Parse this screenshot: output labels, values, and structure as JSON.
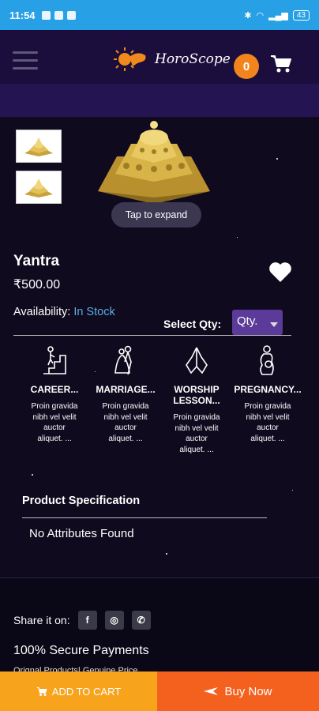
{
  "status_bar": {
    "time": "11:54",
    "battery": "43"
  },
  "header": {
    "app_name": "HoroScope",
    "cart_count": "0"
  },
  "product": {
    "tap_to_expand": "Tap to expand",
    "name": "Yantra",
    "price": "₹500.00",
    "availability_label": "Availability:",
    "availability_value": "In Stock",
    "select_qty_label": "Select Qty:",
    "qty_placeholder": "Qty."
  },
  "benefits": [
    {
      "title": "CAREER...",
      "desc": "Proin gravida nibh vel velit auctor aliquet. ...",
      "icon": "career-stairs-icon"
    },
    {
      "title": "MARRIAGE...",
      "desc": "Proin gravida nibh vel velit auctor aliquet. ...",
      "icon": "marriage-couple-icon"
    },
    {
      "title": "WORSHIP LESSON...",
      "desc": "Proin gravida nibh vel velit auctor aliquet. ...",
      "icon": "praying-hands-icon"
    },
    {
      "title": "PREGNANCY...",
      "desc": "Proin gravida nibh vel velit auctor aliquet. ...",
      "icon": "pregnancy-icon"
    }
  ],
  "specification": {
    "title": "Product Specification",
    "empty_message": "No Attributes Found"
  },
  "footer": {
    "share_label": "Share it on:",
    "secure_payments": "100% Secure Payments",
    "genuine_text": "Orignal Products| Genuine Price"
  },
  "actions": {
    "add_to_cart": "ADD TO CART",
    "buy_now": "Buy Now"
  },
  "colors": {
    "background": "#0f0a1e",
    "status_bar": "#27a0e6",
    "header": "#1b0e3d",
    "badge": "#f2841e",
    "stock_link": "#5aaee4",
    "qty_select": "#5b3a9a",
    "add_to_cart": "#f8a31c",
    "buy_now": "#f4611f"
  }
}
